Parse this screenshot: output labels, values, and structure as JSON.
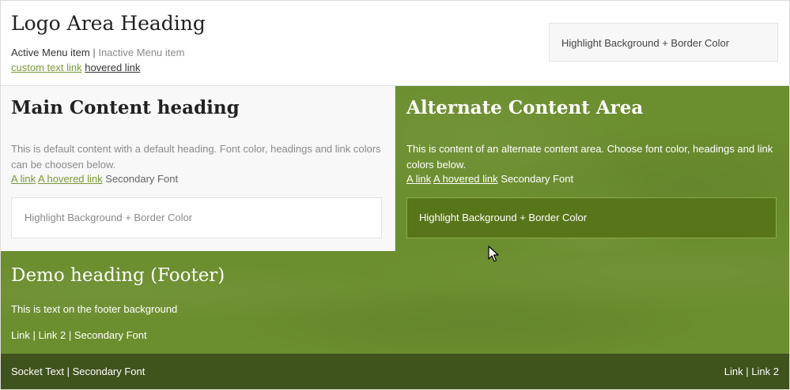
{
  "header": {
    "logo_heading": "Logo Area Heading",
    "menu": {
      "active": "Active Menu item",
      "separator": "|",
      "inactive": "Inactive Menu item"
    },
    "links": {
      "custom": "custom text link",
      "hovered": "hovered link"
    },
    "highlight_box": "Highlight Background + Border Color"
  },
  "main": {
    "heading": "Main Content heading",
    "text": "This is default content with a default heading. Font color, headings and link colors can be choosen below.",
    "link": "A link",
    "hovered_link": "A hovered link",
    "secondary_font": "Secondary Font",
    "highlight_box": "Highlight Background + Border Color"
  },
  "alternate": {
    "heading": "Alternate Content Area",
    "text": "This is content of an alternate content area. Choose font color, headings and link colors below.",
    "link": "A link",
    "hovered_link": "A hovered link",
    "secondary_font": "Secondary Font",
    "highlight_box": "Highlight Background + Border Color"
  },
  "footer": {
    "heading": "Demo heading (Footer)",
    "text": "This is text on the footer background",
    "link1": "Link",
    "link2": "Link 2",
    "secondary_font": "Secondary Font",
    "separator": "|"
  },
  "socket": {
    "text": "Socket Text",
    "secondary_font": "Secondary Font",
    "link1": "Link",
    "link2": "Link 2",
    "separator": "|"
  },
  "colors": {
    "accent_green": "#6b8e2e",
    "socket_green": "#3f531c",
    "link_green": "#7a9a3a",
    "alt_box_green": "#577519"
  }
}
